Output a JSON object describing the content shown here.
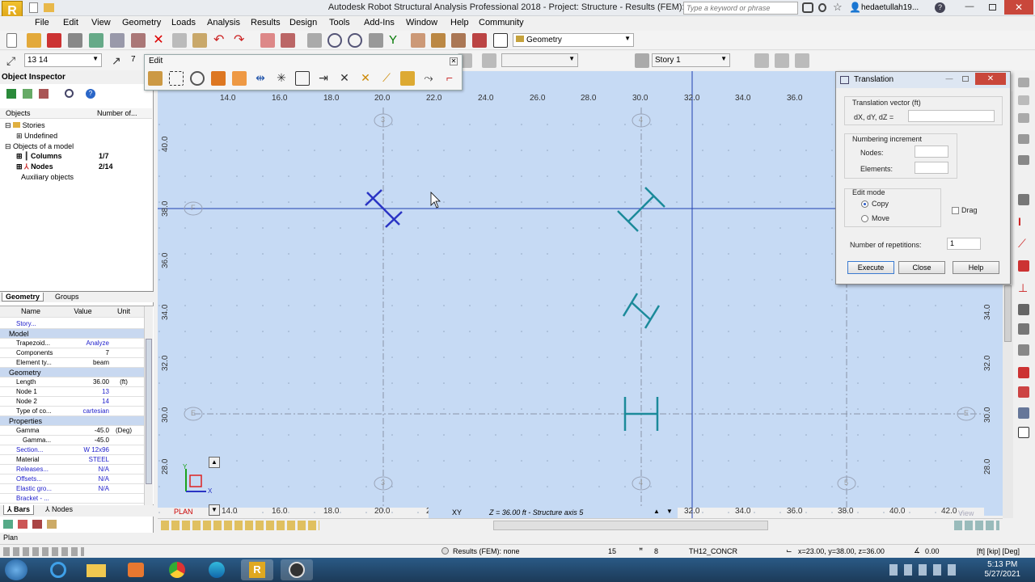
{
  "window": {
    "title": "Autodesk Robot Structural Analysis Professional 2018 - Project: Structure - Results (FEM): none",
    "logo": "R"
  },
  "search": {
    "placeholder": "Type a keyword or phrase"
  },
  "user": {
    "name": "hedaetullah19..."
  },
  "menu": [
    "File",
    "Edit",
    "View",
    "Geometry",
    "Loads",
    "Analysis",
    "Results",
    "Design",
    "Tools",
    "Add-Ins",
    "Window",
    "Help",
    "Community"
  ],
  "toolbar": {
    "layout_combo": "Geometry",
    "selection_combo": "13 14",
    "selection_count": "7",
    "story_combo": "Story 1"
  },
  "edit_toolbar": {
    "title": "Edit"
  },
  "inspector": {
    "title": "Object Inspector",
    "col_objects": "Objects",
    "col_number": "Number of...",
    "tree": {
      "stories": "Stories",
      "undefined": "Undefined",
      "objects_of_model": "Objects of a model",
      "columns": "Columns",
      "columns_count": "1/7",
      "nodes": "Nodes",
      "nodes_count": "2/14",
      "auxiliary": "Auxiliary objects"
    },
    "tabs": {
      "geometry": "Geometry",
      "groups": "Groups"
    },
    "prop_headers": {
      "name": "Name",
      "value": "Value",
      "unit": "Unit"
    },
    "props": {
      "story": "Story...",
      "model": "Model",
      "trapezoid": "Trapezoid...",
      "trapezoid_val": "Analyze",
      "components": "Components",
      "components_val": "7",
      "element_type": "Element ty...",
      "element_type_val": "beam",
      "geometry": "Geometry",
      "length": "Length",
      "length_val": "36.00",
      "length_unit": "(ft)",
      "node1": "Node 1",
      "node1_val": "13",
      "node2": "Node 2",
      "node2_val": "14",
      "type_coord": "Type of co...",
      "type_coord_val": "cartesian",
      "properties": "Properties",
      "gamma": "Gamma",
      "gamma_val": "-45.0",
      "gamma_unit": "(Deg)",
      "gamma2": "Gamma...",
      "gamma2_val": "-45.0",
      "section": "Section...",
      "section_val": "W 12x96",
      "material": "Material",
      "material_val": "STEEL",
      "releases": "Releases...",
      "releases_val": "N/A",
      "offsets": "Offsets...",
      "offsets_val": "N/A",
      "elastic": "Elastic gro...",
      "elastic_val": "N/A",
      "bracket": "Bracket - ..."
    },
    "bottom_tabs": {
      "bars": "Bars",
      "nodes": "Nodes"
    }
  },
  "canvas": {
    "x_ticks_top": [
      "14.0",
      "16.0",
      "18.0",
      "20.0",
      "22.0",
      "24.0",
      "26.0",
      "28.0",
      "30.0",
      "32.0",
      "34.0",
      "36.0"
    ],
    "x_ticks_bottom": [
      "14.0",
      "16.0",
      "18.0",
      "20.0",
      "2",
      "32.0",
      "34.0",
      "36.0",
      "38.0",
      "40.0",
      "42.0"
    ],
    "y_ticks_left": [
      "40.0",
      "38.0",
      "36.0",
      "34.0",
      "32.0",
      "30.0",
      "28.0"
    ],
    "y_ticks_right": [
      "34.0",
      "32.0",
      "30.0",
      "28.0"
    ],
    "axis_bubbles": {
      "a3": "3",
      "a4": "4",
      "a5": "5",
      "aF": "F",
      "aE": "E"
    },
    "plan_label": "PLAN",
    "view_label": "View",
    "status_strip": {
      "coord": "XY",
      "info": "Z = 36.00 ft - Structure axis 5"
    },
    "gizmo": {
      "y": "Y",
      "x": "X"
    }
  },
  "translation_dialog": {
    "title": "Translation",
    "vector_label": "Translation vector (ft)",
    "dxdydz": "dX, dY, dZ  =",
    "numbering": "Numbering increment",
    "nodes": "Nodes:",
    "elements": "Elements:",
    "edit_mode": "Edit mode",
    "copy": "Copy",
    "move": "Move",
    "drag": "Drag",
    "repetitions_label": "Number of repetitions:",
    "repetitions_val": "1",
    "execute": "Execute",
    "close": "Close",
    "help": "Help"
  },
  "plan_bar": {
    "label": "Plan"
  },
  "status": {
    "results": "Results (FEM): none",
    "n1": "15",
    "n2": "8",
    "section": "TH12_CONCR",
    "coords": "x=23.00, y=38.00, z=36.00",
    "angle": "0.00",
    "units": "[ft] [kip] [Deg]"
  },
  "taskbar": {
    "time": "5:13 PM",
    "date": "5/27/2021"
  }
}
